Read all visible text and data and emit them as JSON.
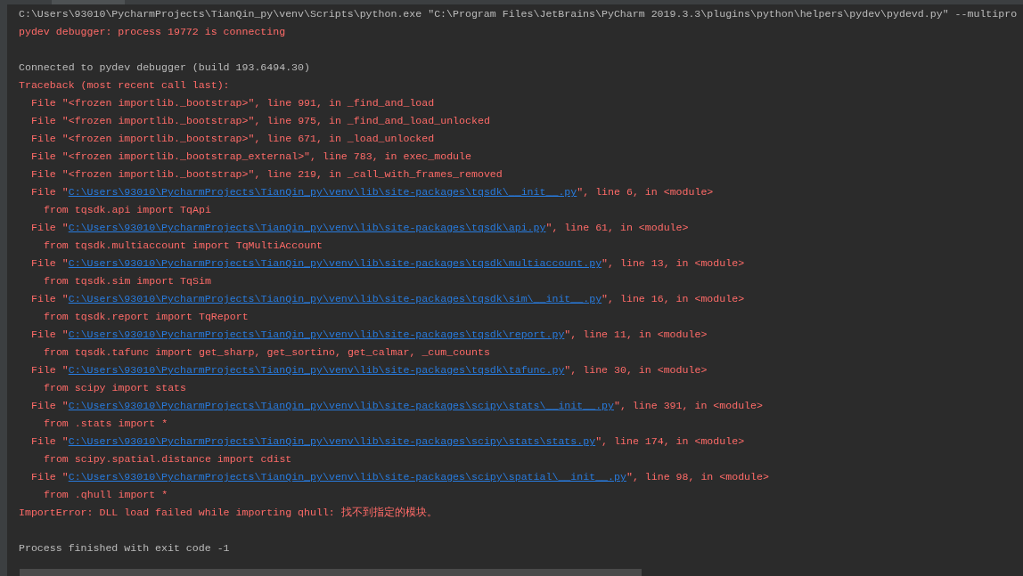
{
  "console": {
    "lines": [
      {
        "kind": "plain",
        "text": "C:\\Users\\93010\\PycharmProjects\\TianQin_py\\venv\\Scripts\\python.exe \"C:\\Program Files\\JetBrains\\PyCharm 2019.3.3\\plugins\\python\\helpers\\pydev\\pydevd.py\" --multipro"
      },
      {
        "kind": "error",
        "text": "pydev debugger: process 19772 is connecting"
      },
      {
        "kind": "blank"
      },
      {
        "kind": "plain",
        "text": "Connected to pydev debugger (build 193.6494.30)"
      },
      {
        "kind": "error",
        "text": "Traceback (most recent call last):"
      },
      {
        "kind": "frame",
        "text": "File \"<frozen importlib._bootstrap>\", line 991, in _find_and_load"
      },
      {
        "kind": "frame",
        "text": "File \"<frozen importlib._bootstrap>\", line 975, in _find_and_load_unlocked"
      },
      {
        "kind": "frame",
        "text": "File \"<frozen importlib._bootstrap>\", line 671, in _load_unlocked"
      },
      {
        "kind": "frame",
        "text": "File \"<frozen importlib._bootstrap_external>\", line 783, in exec_module"
      },
      {
        "kind": "frame",
        "text": "File \"<frozen importlib._bootstrap>\", line 219, in _call_with_frames_removed"
      },
      {
        "kind": "link_frame",
        "prefix": "File \"",
        "link": "C:\\Users\\93010\\PycharmProjects\\TianQin_py\\venv\\lib\\site-packages\\tqsdk\\__init__.py",
        "suffix": "\", line 6, in <module>"
      },
      {
        "kind": "code",
        "text": "from tqsdk.api import TqApi"
      },
      {
        "kind": "link_frame",
        "prefix": "File \"",
        "link": "C:\\Users\\93010\\PycharmProjects\\TianQin_py\\venv\\lib\\site-packages\\tqsdk\\api.py",
        "suffix": "\", line 61, in <module>"
      },
      {
        "kind": "code",
        "text": "from tqsdk.multiaccount import TqMultiAccount"
      },
      {
        "kind": "link_frame",
        "prefix": "File \"",
        "link": "C:\\Users\\93010\\PycharmProjects\\TianQin_py\\venv\\lib\\site-packages\\tqsdk\\multiaccount.py",
        "suffix": "\", line 13, in <module>"
      },
      {
        "kind": "code",
        "text": "from tqsdk.sim import TqSim"
      },
      {
        "kind": "link_frame",
        "prefix": "File \"",
        "link": "C:\\Users\\93010\\PycharmProjects\\TianQin_py\\venv\\lib\\site-packages\\tqsdk\\sim\\__init__.py",
        "suffix": "\", line 16, in <module>"
      },
      {
        "kind": "code",
        "text": "from tqsdk.report import TqReport"
      },
      {
        "kind": "link_frame",
        "prefix": "File \"",
        "link": "C:\\Users\\93010\\PycharmProjects\\TianQin_py\\venv\\lib\\site-packages\\tqsdk\\report.py",
        "suffix": "\", line 11, in <module>"
      },
      {
        "kind": "code",
        "text": "from tqsdk.tafunc import get_sharp, get_sortino, get_calmar, _cum_counts"
      },
      {
        "kind": "link_frame",
        "prefix": "File \"",
        "link": "C:\\Users\\93010\\PycharmProjects\\TianQin_py\\venv\\lib\\site-packages\\tqsdk\\tafunc.py",
        "suffix": "\", line 30, in <module>"
      },
      {
        "kind": "code",
        "text": "from scipy import stats"
      },
      {
        "kind": "link_frame",
        "prefix": "File \"",
        "link": "C:\\Users\\93010\\PycharmProjects\\TianQin_py\\venv\\lib\\site-packages\\scipy\\stats\\__init__.py",
        "suffix": "\", line 391, in <module>"
      },
      {
        "kind": "code",
        "text": "from .stats import *"
      },
      {
        "kind": "link_frame",
        "prefix": "File \"",
        "link": "C:\\Users\\93010\\PycharmProjects\\TianQin_py\\venv\\lib\\site-packages\\scipy\\stats\\stats.py",
        "suffix": "\", line 174, in <module>"
      },
      {
        "kind": "code",
        "text": "from scipy.spatial.distance import cdist"
      },
      {
        "kind": "link_frame",
        "prefix": "File \"",
        "link": "C:\\Users\\93010\\PycharmProjects\\TianQin_py\\venv\\lib\\site-packages\\scipy\\spatial\\__init__.py",
        "suffix": "\", line 98, in <module>"
      },
      {
        "kind": "code",
        "text": "from .qhull import *"
      },
      {
        "kind": "error",
        "text": "ImportError: DLL load failed while importing qhull: 找不到指定的模块。"
      },
      {
        "kind": "blank"
      },
      {
        "kind": "plain",
        "text": "Process finished with exit code -1"
      }
    ]
  }
}
